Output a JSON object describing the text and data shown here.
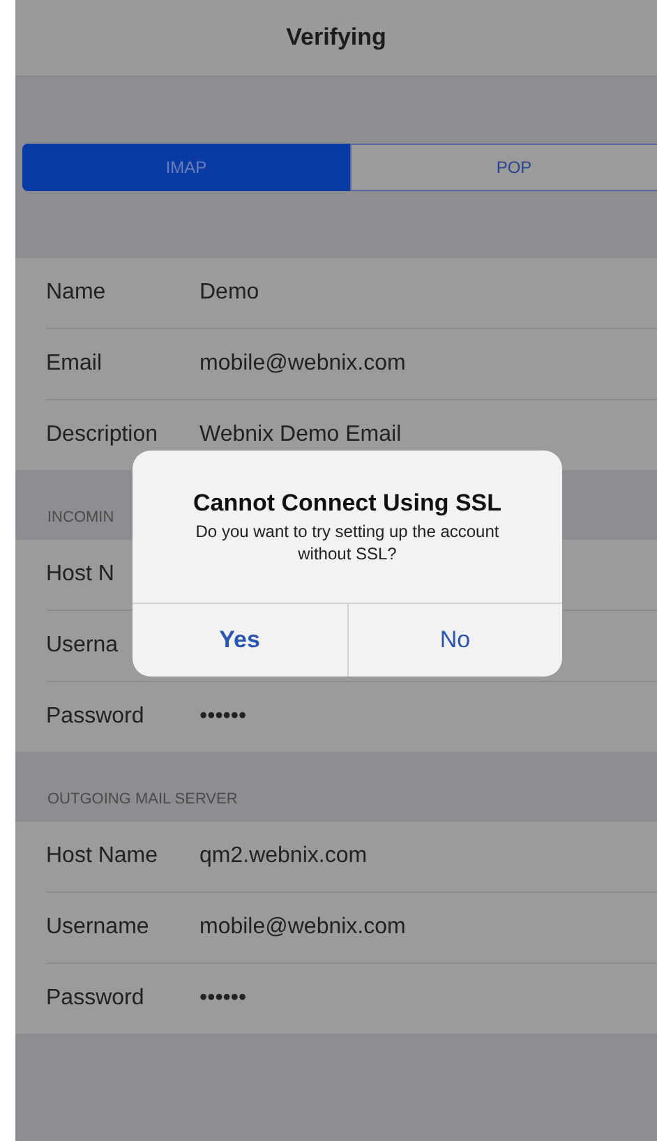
{
  "nav": {
    "title": "Verifying"
  },
  "segments": [
    {
      "label": "IMAP",
      "selected": true
    },
    {
      "label": "POP",
      "selected": false
    }
  ],
  "account": [
    {
      "label": "Name",
      "value": "Demo"
    },
    {
      "label": "Email",
      "value": "mobile@webnix.com"
    },
    {
      "label": "Description",
      "value": "Webnix Demo Email"
    }
  ],
  "incoming": {
    "header": "INCOMIN",
    "rows": [
      {
        "label": "Host N"
      },
      {
        "label": "Userna"
      },
      {
        "label": "Password",
        "value": "••••••"
      }
    ]
  },
  "outgoing": {
    "header": "OUTGOING MAIL SERVER",
    "rows": [
      {
        "label": "Host Name",
        "value": "qm2.webnix.com"
      },
      {
        "label": "Username",
        "value": "mobile@webnix.com"
      },
      {
        "label": "Password",
        "value": "••••••"
      }
    ]
  },
  "alert": {
    "title": "Cannot Connect Using SSL",
    "message": "Do you want to try setting up the account without SSL?",
    "buttons": [
      "Yes",
      "No"
    ]
  }
}
